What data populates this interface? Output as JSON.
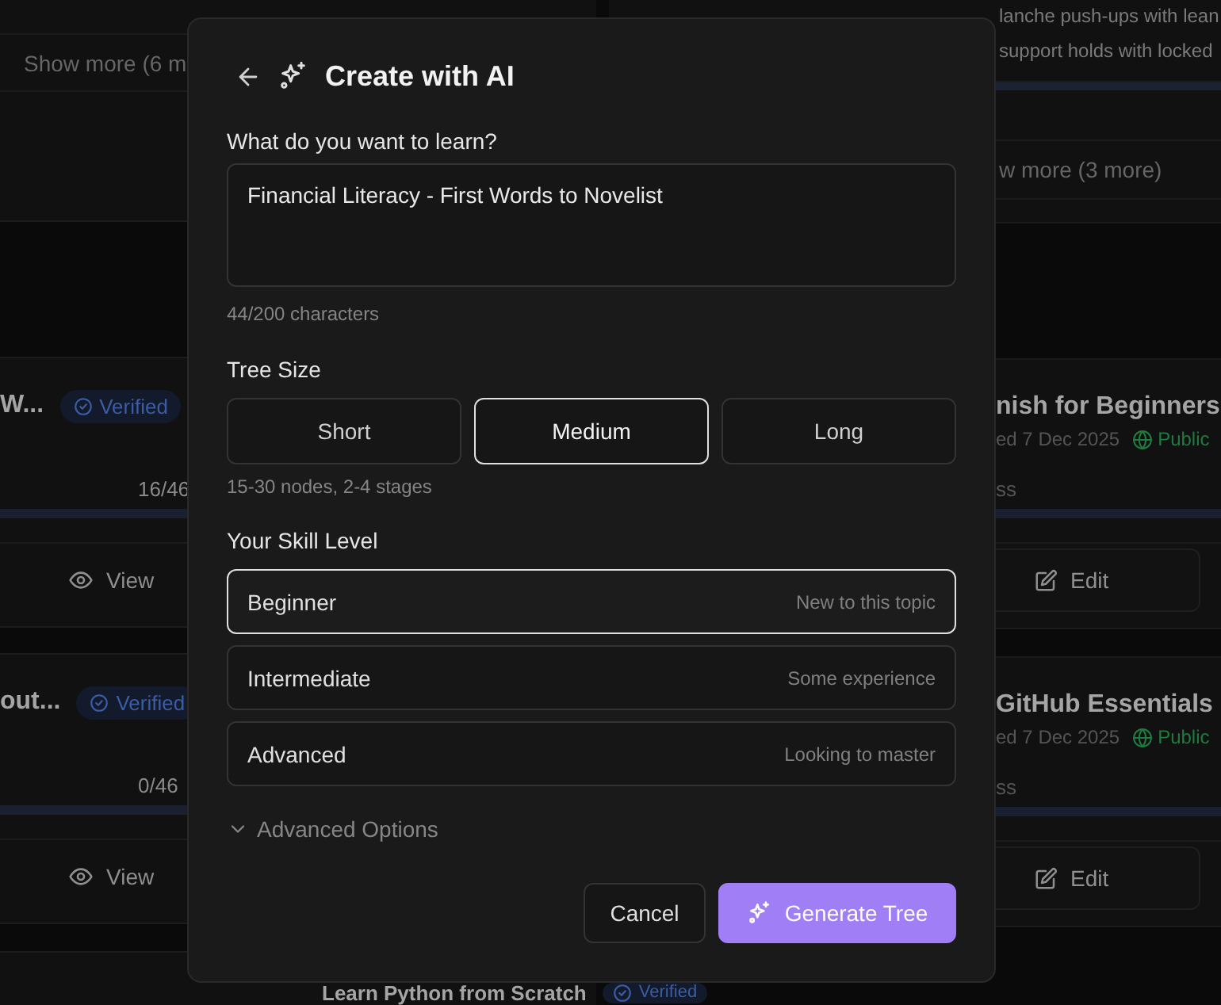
{
  "background": {
    "task": {
      "text": "lanche push-ups with lean",
      "continuation": "support holds with locked",
      "level": 1
    },
    "show_more": [
      "Show more (6 m",
      "w more (3 more)"
    ],
    "left_cards": [
      {
        "title": "W...",
        "badge": "Verified",
        "progress": "16/46",
        "action": "View"
      },
      {
        "title": "out...",
        "badge": "Verified",
        "progress": "0/46",
        "action": "View"
      }
    ],
    "right_cards": [
      {
        "title": "nish for Beginners",
        "date": "ed 7 Dec 2025",
        "visibility": "Public",
        "progress_label": "ss",
        "action": "Edit"
      },
      {
        "title": "GitHub Essentials",
        "date": "ed 7 Dec 2025",
        "visibility": "Public",
        "progress_label": "ss",
        "action": "Edit"
      }
    ],
    "bottom_card": {
      "title": "Learn Python from Scratch",
      "badge": "Verified"
    }
  },
  "dialog": {
    "title": "Create with AI",
    "topic": {
      "label": "What do you want to learn?",
      "value": "Financial Literacy - First Words to Novelist",
      "counter": "44/200 characters"
    },
    "tree_size": {
      "label": "Tree Size",
      "options": [
        {
          "label": "Short",
          "selected": false
        },
        {
          "label": "Medium",
          "selected": true
        },
        {
          "label": "Long",
          "selected": false
        }
      ],
      "hint": "15-30 nodes, 2-4 stages"
    },
    "skill_level": {
      "label": "Your Skill Level",
      "options": [
        {
          "label": "Beginner",
          "description": "New to this topic",
          "selected": true
        },
        {
          "label": "Intermediate",
          "description": "Some experience",
          "selected": false
        },
        {
          "label": "Advanced",
          "description": "Looking to master",
          "selected": false
        }
      ]
    },
    "advanced_options": {
      "label": "Advanced Options",
      "expanded": false
    },
    "buttons": [
      {
        "label": "Cancel",
        "kind": "secondary"
      },
      {
        "label": "Generate Tree",
        "kind": "primary"
      }
    ]
  }
}
